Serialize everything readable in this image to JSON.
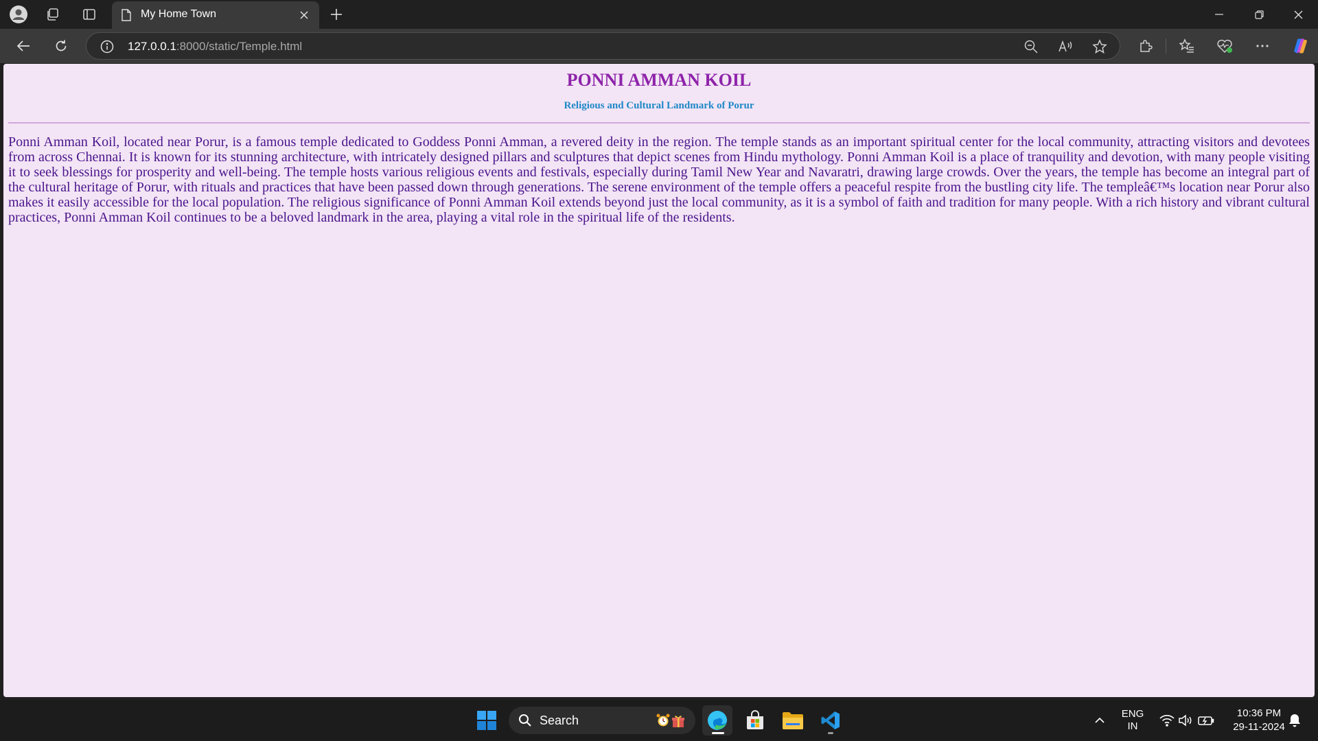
{
  "browser": {
    "tab_title": "My Home Town",
    "url_host": "127.0.0.1",
    "url_path": ":8000/static/Temple.html"
  },
  "page": {
    "title": "PONNI AMMAN KOIL",
    "subtitle": "Religious and Cultural Landmark of Porur",
    "paragraph": "Ponni Amman Koil, located near Porur, is a famous temple dedicated to Goddess Ponni Amman, a revered deity in the region. The temple stands as an important spiritual center for the local community, attracting visitors and devotees from across Chennai. It is known for its stunning architecture, with intricately designed pillars and sculptures that depict scenes from Hindu mythology. Ponni Amman Koil is a place of tranquility and devotion, with many people visiting it to seek blessings for prosperity and well-being. The temple hosts various religious events and festivals, especially during Tamil New Year and Navaratri, drawing large crowds. Over the years, the temple has become an integral part of the cultural heritage of Porur, with rituals and practices that have been passed down through generations. The serene environment of the temple offers a peaceful respite from the bustling city life. The templeâ€™s location near Porur also makes it easily accessible for the local population. The religious significance of Ponni Amman Koil extends beyond just the local community, as it is a symbol of faith and tradition for many people. With a rich history and vibrant cultural practices, Ponni Amman Koil continues to be a beloved landmark in the area, playing a vital role in the spiritual life of the residents."
  },
  "taskbar": {
    "search_label": "Search",
    "lang_line1": "ENG",
    "lang_line2": "IN",
    "time": "10:36 PM",
    "date": "29-11-2024"
  },
  "colors": {
    "page_background": "#f3e5f5",
    "title": "#8e24aa",
    "subtitle": "#1e88c7",
    "body_text": "#4a148c"
  }
}
